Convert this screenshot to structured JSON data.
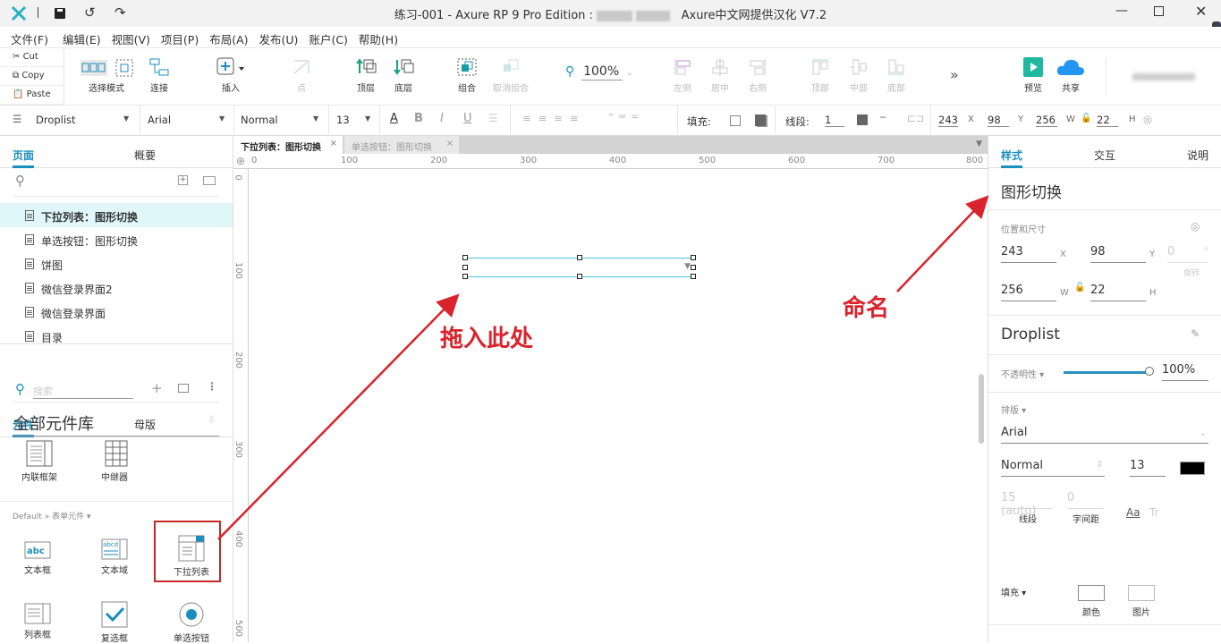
{
  "window": {
    "title": "练习-001 - Axure RP 9 Pro Edition :",
    "title_suffix": "Axure中文网提供汉化 V7.2",
    "controls": {
      "minimize": "minimize-icon",
      "maximize": "maximize-icon",
      "close": "close-icon"
    }
  },
  "menu": [
    "文件(F)",
    "编辑(E)",
    "视图(V)",
    "项目(P)",
    "布局(A)",
    "发布(U)",
    "账户(C)",
    "帮助(H)"
  ],
  "clipboard": {
    "cut": "Cut",
    "copy": "Copy",
    "paste": "Paste"
  },
  "toolbar": {
    "select_mode": "选择模式",
    "connect": "连接",
    "insert": "插入",
    "point": "点",
    "top_layer": "顶层",
    "bottom_layer": "底层",
    "group": "组合",
    "ungroup": "取消组合",
    "zoom": "100%",
    "align_left": "左侧",
    "align_center": "居中",
    "align_right": "右侧",
    "align_top": "顶部",
    "align_middle": "中部",
    "align_bottom": "底部",
    "more": "»",
    "preview": "预览",
    "share": "共享"
  },
  "stylebar": {
    "widget_type": "Droplist",
    "font": "Arial",
    "weight": "Normal",
    "size": "13",
    "fill_label": "填充:",
    "stroke_label": "线段:",
    "stroke_width": "1",
    "x": "243",
    "x_label": "X",
    "y": "98",
    "y_label": "Y",
    "w": "256",
    "w_label": "W",
    "h": "22",
    "h_label": "H"
  },
  "left": {
    "pages_tab": "页面",
    "outline_tab": "概要",
    "pages": [
      "下拉列表：图形切换",
      "单选按钮：图形切换",
      "饼图",
      "微信登录界面2",
      "微信登录界面",
      "目录"
    ],
    "widgets_tab": "元件",
    "masters_tab": "母版",
    "search_placeholder": "搜索",
    "library": "全部元件库",
    "top_widgets": [
      "内联框架",
      "中继器"
    ],
    "category": "Default » 表单元件 ▾",
    "form_widgets": [
      "文本框",
      "文本域",
      "下拉列表",
      "列表框",
      "复选框",
      "单选按钮"
    ]
  },
  "canvas": {
    "tabs": [
      "下拉列表：图形切换",
      "单选按钮：图形切换"
    ],
    "hruler": [
      "0",
      "100",
      "200",
      "300",
      "400",
      "500",
      "600",
      "700",
      "800"
    ],
    "vruler": [
      "0",
      "100",
      "200",
      "300",
      "400",
      "500"
    ]
  },
  "annotations": {
    "drag_here": "拖入此处",
    "naming": "命名"
  },
  "right": {
    "tabs": [
      "样式",
      "交互",
      "说明"
    ],
    "name": "图形切换",
    "pos_label": "位置和尺寸",
    "x": "243",
    "y": "98",
    "rotation": "0",
    "rotation_label": "旋转",
    "w": "256",
    "h": "22",
    "widget_type": "Droplist",
    "opacity_label": "不透明性 ▾",
    "opacity": "100%",
    "opacity_value": 1.0,
    "typography_label": "排版 ▾",
    "font": "Arial",
    "weight": "Normal",
    "size": "13",
    "color": "#000000",
    "line_height": "15 (auto)",
    "letter_spacing": "0",
    "line_label": "线段",
    "spacing_label": "字间距",
    "fill_label": "填充 ▾",
    "fill_color": "颜色",
    "fill_image": "图片"
  },
  "colors": {
    "accent": "#1a8fbf",
    "annotation": "#d9232d",
    "preview": "#1fb8a0",
    "share": "#2196f3"
  }
}
